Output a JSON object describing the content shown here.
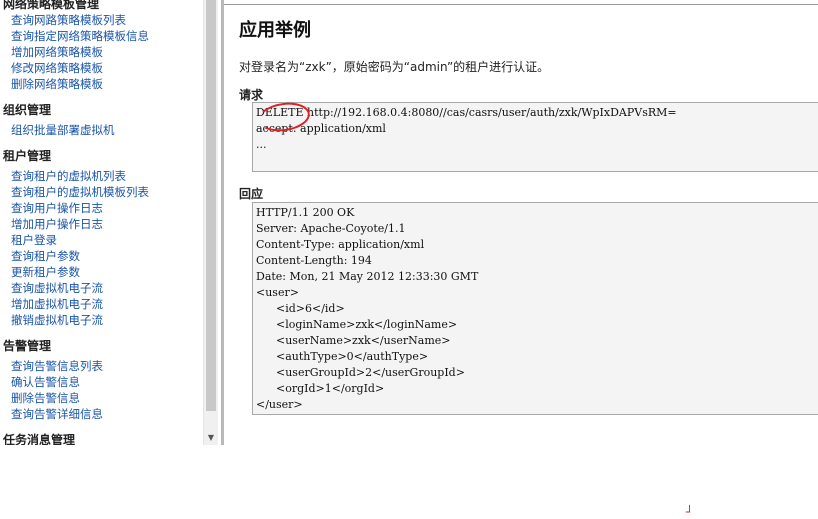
{
  "sidebar": {
    "groups": [
      {
        "title": "网络策略模板管理",
        "items": [
          "查询网路策略模板列表",
          "查询指定网络策略模板信息",
          "增加网络策略模板",
          "修改网络策略模板",
          "删除网络策略模板"
        ]
      },
      {
        "title": "组织管理",
        "items": [
          "组织批量部署虚拟机"
        ]
      },
      {
        "title": "租户管理",
        "items": [
          "查询租户的虚拟机列表",
          "查询租户的虚拟机模板列表",
          "查询用户操作日志",
          "增加用户操作日志",
          "租户登录",
          "查询租户参数",
          "更新租户参数",
          "查询虚拟机电子流",
          "增加虚拟机电子流",
          "撤销虚拟机电子流"
        ]
      },
      {
        "title": "告警管理",
        "items": [
          "查询告警信息列表",
          "确认告警信息",
          "删除告警信息",
          "查询告警详细信息"
        ]
      },
      {
        "title": "任务消息管理",
        "items": []
      }
    ]
  },
  "main": {
    "title": "应用举例",
    "description": "对登录名为“zxk”，原始密码为“admin”的租户进行认证。",
    "request_label": "请求",
    "request_lines": [
      "DELETE http://192.168.0.4:8080//cas/casrs/user/auth/zxk/WpIxDAPVsRM=",
      "accept: application/xml",
      "..."
    ],
    "response_label": "回应",
    "response_lines": [
      "HTTP/1.1 200 OK",
      "Server: Apache-Coyote/1.1",
      "Content-Type: application/xml",
      "Content-Length: 194",
      "Date: Mon, 21 May 2012 12:33:30 GMT",
      "<user>",
      "<id>6</id>",
      "<loginName>zxk</loginName>",
      "<userName>zxk</userName>",
      "<authType>0</authType>",
      "<userGroupId>2</userGroupId>",
      "<orgId>1</orgId>",
      "</user>"
    ]
  },
  "accent_colors": {
    "link": "#1a55a8",
    "annotation": "#e02020"
  }
}
